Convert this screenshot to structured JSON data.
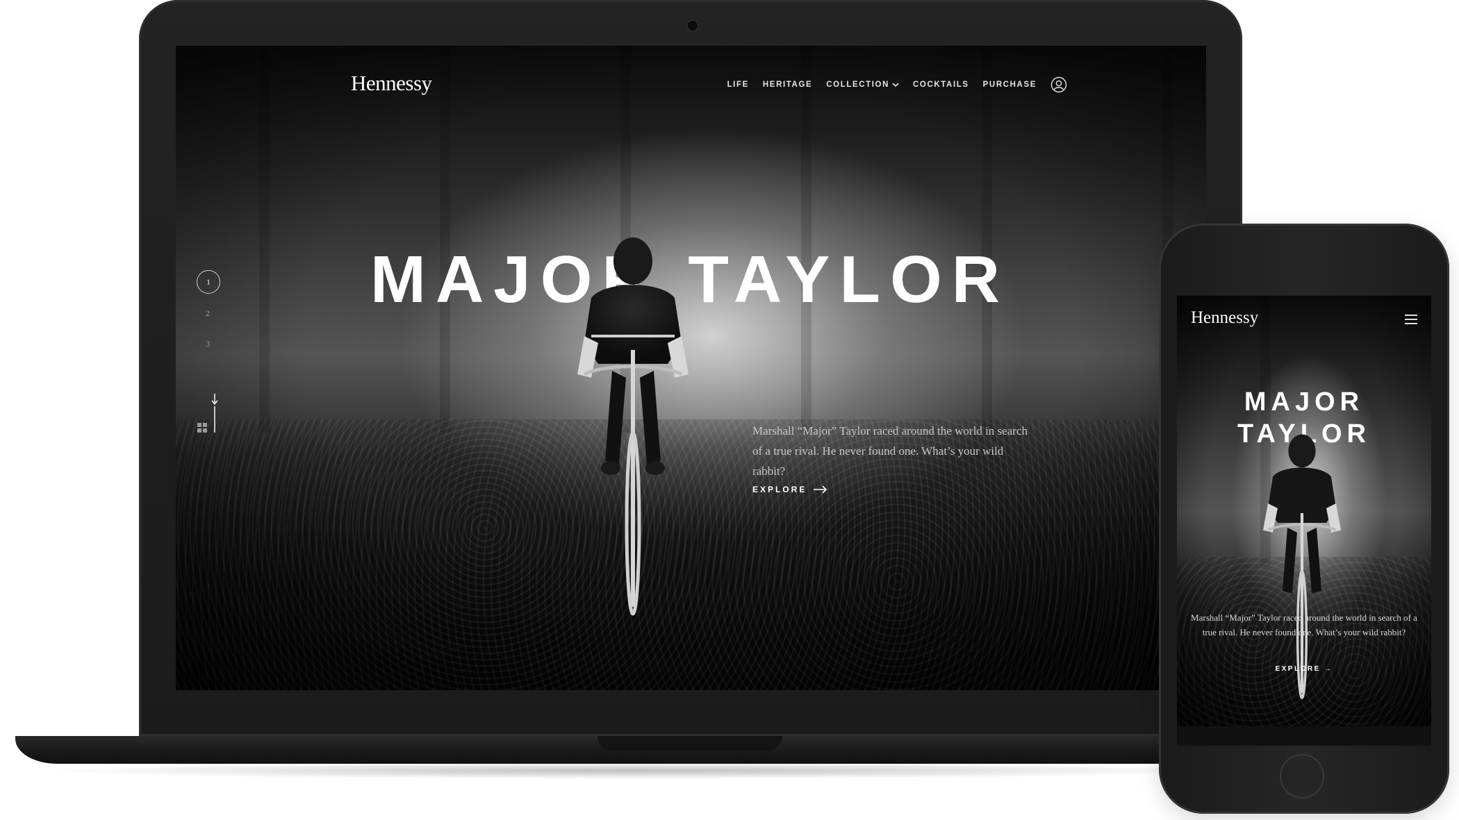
{
  "brand": {
    "logo_text": "Hennessy"
  },
  "laptop_site": {
    "nav": {
      "items": [
        "LIFE",
        "HERITAGE",
        "COLLECTION",
        "COCKTAILS",
        "PURCHASE"
      ],
      "collection_has_dropdown": true,
      "account_icon": "user-circle-icon"
    },
    "slide_nav": {
      "items": [
        "1",
        "2",
        "3"
      ],
      "active": "1",
      "grid_icon": "grid-icon",
      "scroll_icon": "scroll-down-icon"
    },
    "hero": {
      "title": "MAJOR TAYLOR",
      "copy": "Marshall “Major” Taylor raced around the world in search of a true rival. He never found one. What’s your wild rabbit?",
      "cta": "EXPLORE",
      "cta_icon": "arrow-right-icon"
    }
  },
  "phone_site": {
    "menu_icon": "hamburger-menu-icon",
    "hero": {
      "title_line1": "MAJOR",
      "title_line2": "TAYLOR",
      "copy": "Marshall “Major” Taylor raced around the world in search of a true rival. He never found one. What’s your wild rabbit?",
      "cta": "EXPLORE"
    }
  },
  "colors": {
    "device": "#1e1e1e",
    "text": "#ffffff",
    "muted_text": "#c8c8c8"
  }
}
